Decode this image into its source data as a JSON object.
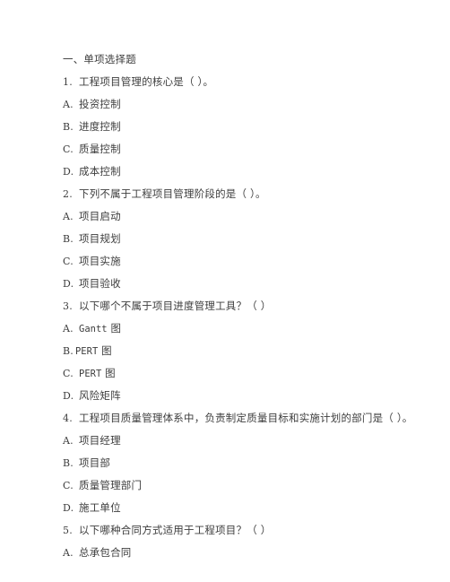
{
  "document": {
    "heading": "一、单项选择题",
    "questions": [
      {
        "number": "1.",
        "stem": "工程项目管理的核心是（ ）。",
        "options": [
          {
            "letter": "A.",
            "text": "投资控制",
            "tight": false
          },
          {
            "letter": "B.",
            "text": "进度控制",
            "tight": false
          },
          {
            "letter": "C.",
            "text": "质量控制",
            "tight": false
          },
          {
            "letter": "D.",
            "text": "成本控制",
            "tight": false
          }
        ]
      },
      {
        "number": "2.",
        "stem": "下列不属于工程项目管理阶段的是（ ）。",
        "options": [
          {
            "letter": "A.",
            "text": "项目启动",
            "tight": false
          },
          {
            "letter": "B.",
            "text": "项目规划",
            "tight": false
          },
          {
            "letter": "C.",
            "text": "项目实施",
            "tight": false
          },
          {
            "letter": "D.",
            "text": "项目验收",
            "tight": false
          }
        ]
      },
      {
        "number": "3.",
        "stem": "以下哪个不属于项目进度管理工具？（ ）",
        "options": [
          {
            "letter": "A.",
            "latin": "Gantt",
            "text": " 图",
            "tight": false
          },
          {
            "letter": "B.",
            "latin": "PERT",
            "text": " 图",
            "tight": true
          },
          {
            "letter": "C.",
            "latin": "PERT",
            "text": " 图",
            "tight": false
          },
          {
            "letter": "D.",
            "text": "风险矩阵",
            "tight": false
          }
        ]
      },
      {
        "number": "4.",
        "stem": "工程项目质量管理体系中，负责制定质量目标和实施计划的部门是（ ）。",
        "options": [
          {
            "letter": "A.",
            "text": "项目经理",
            "tight": false
          },
          {
            "letter": "B.",
            "text": "项目部",
            "tight": false
          },
          {
            "letter": "C.",
            "text": "质量管理部门",
            "tight": false
          },
          {
            "letter": "D.",
            "text": "施工单位",
            "tight": false
          }
        ]
      },
      {
        "number": "5.",
        "stem": "以下哪种合同方式适用于工程项目？（ ）",
        "options": [
          {
            "letter": "A.",
            "text": "总承包合同",
            "tight": false
          }
        ]
      }
    ]
  }
}
